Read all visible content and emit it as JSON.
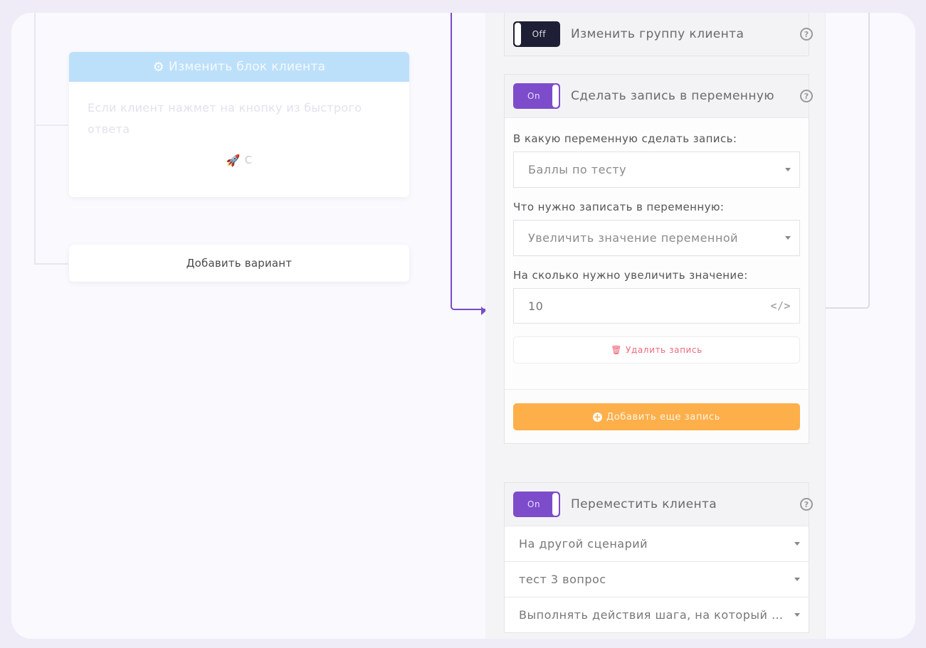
{
  "left": {
    "block_card": {
      "header_icon": "gear-icon",
      "title": "Изменить блок клиента",
      "text": "Если клиент нажмет на кнопку из быстрого ответа",
      "quick_reply": {
        "icon": "rocket-icon",
        "label": "С"
      }
    },
    "add_variant_label": "Добавить вариант"
  },
  "panel": {
    "change_group": {
      "toggle": "Off",
      "title": "Изменить группу клиента",
      "help_icon": "?"
    },
    "write_variable": {
      "toggle": "On",
      "title": "Сделать запись в переменную",
      "help_icon": "?",
      "fields": {
        "variable_label": "В какую переменную сделать запись:",
        "variable_value": "Баллы по тесту",
        "action_label": "Что нужно записать в переменную:",
        "action_value": "Увеличить значение переменной",
        "amount_label": "На сколько нужно увеличить значение:",
        "amount_value": "10",
        "amount_icon": "</>"
      },
      "delete_label": "Удалить запись",
      "add_more_label": "Добавить еще запись"
    },
    "move_client": {
      "toggle": "On",
      "title": "Переместить клиента",
      "help_icon": "?",
      "selects": [
        "На другой сценарий",
        "тест 3 вопрос",
        "Выполнять действия шага, на который …"
      ]
    }
  },
  "colors": {
    "accent_purple": "#7d4ccb",
    "toggle_off": "#1e1f36",
    "orange_button": "#fdaf4a",
    "delete_red": "#eb6a7c",
    "block_header": "#bde0fa"
  }
}
